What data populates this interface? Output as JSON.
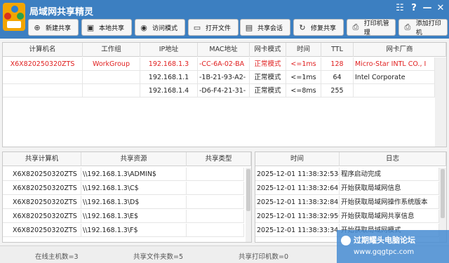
{
  "app": {
    "title": "局域网共享精灵",
    "controls": [
      "☷",
      "?",
      "—",
      "✕"
    ]
  },
  "toolbar": [
    {
      "label": "新建共享",
      "icon": "plus-icon",
      "glyph": "⊕"
    },
    {
      "label": "本地共享",
      "icon": "monitor-icon",
      "glyph": "▣"
    },
    {
      "label": "访问模式",
      "icon": "eye-icon",
      "glyph": "◉"
    },
    {
      "label": "打开文件",
      "icon": "folder-icon",
      "glyph": "▭"
    },
    {
      "label": "共享会话",
      "icon": "chat-icon",
      "glyph": "▤"
    },
    {
      "label": "修复共享",
      "icon": "refresh-icon",
      "glyph": "↻"
    },
    {
      "label": "打印机管理",
      "icon": "printer-icon",
      "glyph": "⎙"
    },
    {
      "label": "添加打印机",
      "icon": "printer-add-icon",
      "glyph": "⎙"
    }
  ],
  "hosts": {
    "headers": [
      "计算机名",
      "工作组",
      "IP地址",
      "MAC地址",
      "网卡模式",
      "时间",
      "TTL",
      "网卡厂商"
    ],
    "rows": [
      [
        "X6X820250320ZTS",
        "WorkGroup",
        "192.168.1.3",
        "-CC-6A-02-BA",
        "正常模式",
        "<=1ms",
        "128",
        "Micro-Star INTL CO., I"
      ],
      [
        "",
        "",
        "192.168.1.1",
        "-1B-21-93-A2-",
        "正常模式",
        "<=1ms",
        "64",
        "Intel Corporate"
      ],
      [
        "",
        "",
        "192.168.1.4",
        "-D6-F4-21-31-",
        "正常模式",
        "<=8ms",
        "255",
        ""
      ]
    ]
  },
  "shares": {
    "headers": [
      "共享计算机",
      "共享资源",
      "共享类型"
    ],
    "rows": [
      [
        "X6X820250320ZTS",
        "\\\\192.168.1.3\\ADMIN$",
        ""
      ],
      [
        "X6X820250320ZTS",
        "\\\\192.168.1.3\\C$",
        ""
      ],
      [
        "X6X820250320ZTS",
        "\\\\192.168.1.3\\D$",
        ""
      ],
      [
        "X6X820250320ZTS",
        "\\\\192.168.1.3\\E$",
        ""
      ],
      [
        "X6X820250320ZTS",
        "\\\\192.168.1.3\\F$",
        ""
      ]
    ]
  },
  "log": {
    "headers": [
      "时间",
      "日志"
    ],
    "rows": [
      [
        "2025-12-01 11:38:32:534",
        "程序启动完成"
      ],
      [
        "2025-12-01 11:38:32:641",
        "开始获取局域网信息"
      ],
      [
        "2025-12-01 11:38:32:842",
        "开始获取局域网操作系统版本"
      ],
      [
        "2025-12-01 11:38:32:950",
        "开始获取局域网共享信息"
      ],
      [
        "2025-12-01 11:38:33:343",
        "开始获取局域网模式"
      ]
    ]
  },
  "status": {
    "online": "在线主机数=3",
    "shared_folders": "共享文件夹数=5",
    "shared_printers": "共享打印机数=0"
  },
  "watermark": {
    "line1": "过期耀头电脑论坛",
    "line2": "www.gqgtpc.com"
  },
  "colors": {
    "accent": "#3c7fc1",
    "highlight": "#e02020"
  }
}
